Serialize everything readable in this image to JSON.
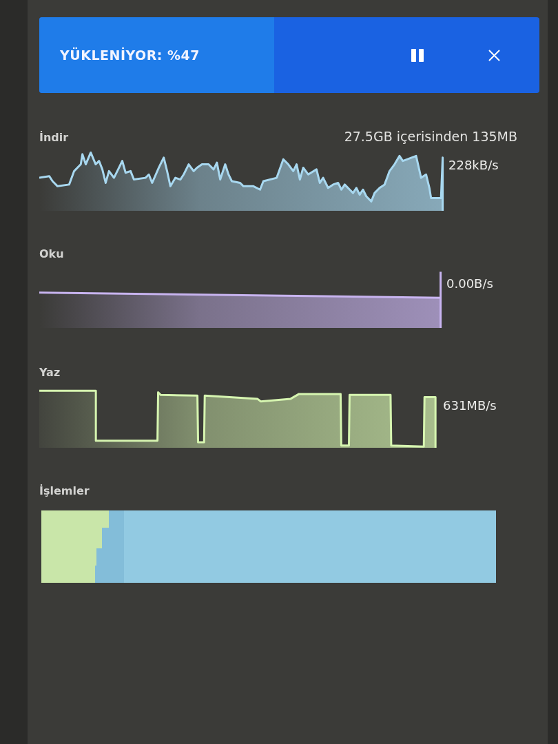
{
  "banner": {
    "status": "YÜKLENİYOR: %47",
    "level": 0.47
  },
  "graphs": [
    {
      "kind": "wave",
      "label": "İndir",
      "detail": "27.5GB içerisinden 135MB",
      "reading": "228kB/s",
      "color": "#a8d8f0"
    },
    {
      "kind": "flat",
      "label": "Oku",
      "reading": "0.00B/s",
      "color": "#c8b4f0"
    },
    {
      "kind": "step",
      "label": "Yaz",
      "reading": "631MB/s",
      "color": "#d6f5b0"
    }
  ],
  "processes": {
    "label": "İşlemler"
  }
}
